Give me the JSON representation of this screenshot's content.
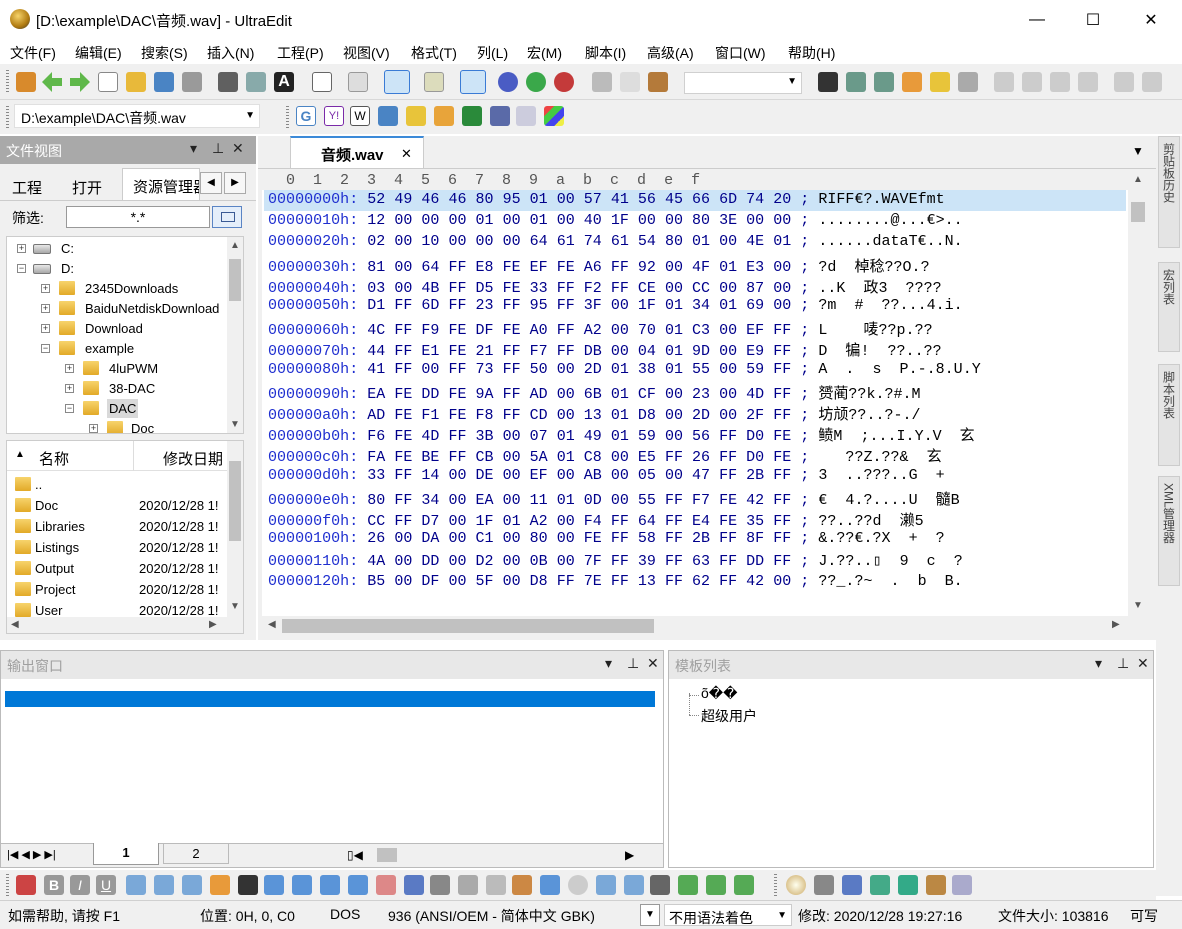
{
  "window": {
    "title": "[D:\\example\\DAC\\音频.wav] - UltraEdit",
    "min": "—",
    "max": "☐",
    "close": "✕"
  },
  "menu": [
    "文件(F)",
    "编辑(E)",
    "搜索(S)",
    "插入(N)",
    "工程(P)",
    "视图(V)",
    "格式(T)",
    "列(L)",
    "宏(M)",
    "脚本(I)",
    "高级(A)",
    "窗口(W)",
    "帮助(H)"
  ],
  "path_combo": "D:\\example\\DAC\\音频.wav",
  "file_view": {
    "title": "文件视图",
    "tabs": [
      "工程",
      "打开",
      "资源管理器"
    ],
    "filter_label": "筛选:",
    "filter_value": "*.*",
    "tree": [
      {
        "label": "C:",
        "level": 0,
        "expander": "+",
        "type": "drive"
      },
      {
        "label": "D:",
        "level": 0,
        "expander": "−",
        "type": "drive"
      },
      {
        "label": "2345Downloads",
        "level": 1,
        "expander": "+",
        "type": "folder"
      },
      {
        "label": "BaiduNetdiskDownload",
        "level": 1,
        "expander": "+",
        "type": "folder"
      },
      {
        "label": "Download",
        "level": 1,
        "expander": "+",
        "type": "folder"
      },
      {
        "label": "example",
        "level": 1,
        "expander": "−",
        "type": "folder"
      },
      {
        "label": "4luPWM",
        "level": 2,
        "expander": "+",
        "type": "folder"
      },
      {
        "label": "38-DAC",
        "level": 2,
        "expander": "+",
        "type": "folder"
      },
      {
        "label": "DAC",
        "level": 2,
        "expander": "−",
        "type": "folder"
      },
      {
        "label": "Doc",
        "level": 3,
        "expander": "+",
        "type": "folder"
      }
    ],
    "list_headers": {
      "name": "名称",
      "date": "修改日期"
    },
    "list": [
      {
        "name": "..",
        "date": ""
      },
      {
        "name": "Doc",
        "date": "2020/12/28 1!"
      },
      {
        "name": "Libraries",
        "date": "2020/12/28 1!"
      },
      {
        "name": "Listings",
        "date": "2020/12/28 1!"
      },
      {
        "name": "Output",
        "date": "2020/12/28 1!"
      },
      {
        "name": "Project",
        "date": "2020/12/28 1!"
      },
      {
        "name": "User",
        "date": "2020/12/28 1!"
      }
    ]
  },
  "editor": {
    "tab": "音频.wav",
    "tab_close": "✕",
    "column_header": "  0  1  2  3  4  5  6  7  8  9  a  b  c  d  e  f",
    "rows": [
      {
        "addr": "00000000h:",
        "hex": "52 49 46 46 80 95 01 00 57 41 56 45 66 6D 74 20",
        "sep": ";",
        "ascii": "RIFF€?.WAVEfmt"
      },
      {
        "addr": "00000010h:",
        "hex": "12 00 00 00 01 00 01 00 40 1F 00 00 80 3E 00 00",
        "sep": ";",
        "ascii": "........@...€>.."
      },
      {
        "addr": "00000020h:",
        "hex": "02 00 10 00 00 00 64 61 74 61 54 80 01 00 4E 01",
        "sep": ";",
        "ascii": "......dataT€..N."
      },
      {
        "addr": "00000030h:",
        "hex": "81 00 64 FF E8 FE EF FE A6 FF 92 00 4F 01 E3 00",
        "sep": ";",
        "ascii": "?d  棹稔??O.?"
      },
      {
        "addr": "00000040h:",
        "hex": "03 00 4B FF D5 FE 33 FF F2 FF CE 00 CC 00 87 00",
        "sep": ";",
        "ascii": "..K  政3  ????"
      },
      {
        "addr": "00000050h:",
        "hex": "D1 FF 6D FF 23 FF 95 FF 3F 00 1F 01 34 01 69 00",
        "sep": ";",
        "ascii": "?m  #  ??...4.i."
      },
      {
        "addr": "00000060h:",
        "hex": "4C FF F9 FE DF FE A0 FF A2 00 70 01 C3 00 EF FF",
        "sep": ";",
        "ascii": "L    唛??p.??"
      },
      {
        "addr": "00000070h:",
        "hex": "44 FF E1 FE 21 FF F7 FF DB 00 04 01 9D 00 E9 FF",
        "sep": ";",
        "ascii": "D  犏!  ??..??"
      },
      {
        "addr": "00000080h:",
        "hex": "41 FF 00 FF 73 FF 50 00 2D 01 38 01 55 00 59 FF",
        "sep": ";",
        "ascii": "A  .  s  P.-.8.U.Y"
      },
      {
        "addr": "00000090h:",
        "hex": "EA FE DD FE 9A FF AD 00 6B 01 CF 00 23 00 4D FF",
        "sep": ";",
        "ascii": "赟蔺??k.?#.M"
      },
      {
        "addr": "000000a0h:",
        "hex": "AD FE F1 FE F8 FF CD 00 13 01 D8 00 2D 00 2F FF",
        "sep": ";",
        "ascii": "坊颃??..?-./"
      },
      {
        "addr": "000000b0h:",
        "hex": "F6 FE 4D FF 3B 00 07 01 49 01 59 00 56 FF D0 FE",
        "sep": ";",
        "ascii": "鲼M  ;...I.Y.V  玄"
      },
      {
        "addr": "000000c0h:",
        "hex": "FA FE BE FF CB 00 5A 01 C8 00 E5 FF 26 FF D0 FE",
        "sep": ";",
        "ascii": "   ??Z.??&  玄"
      },
      {
        "addr": "000000d0h:",
        "hex": "33 FF 14 00 DE 00 EF 00 AB 00 05 00 47 FF 2B FF",
        "sep": ";",
        "ascii": "3  ..???..G  +"
      },
      {
        "addr": "000000e0h:",
        "hex": "80 FF 34 00 EA 00 11 01 0D 00 55 FF F7 FE 42 FF",
        "sep": ";",
        "ascii": "€  4.?....U  髓B"
      },
      {
        "addr": "000000f0h:",
        "hex": "CC FF D7 00 1F 01 A2 00 F4 FF 64 FF E4 FE 35 FF",
        "sep": ";",
        "ascii": "??..??d  濑5"
      },
      {
        "addr": "00000100h:",
        "hex": "26 00 DA 00 C1 00 80 00 FE FF 58 FF 2B FF 8F FF",
        "sep": ";",
        "ascii": "&.??€.?X  +  ?"
      },
      {
        "addr": "00000110h:",
        "hex": "4A 00 DD 00 D2 00 0B 00 7F FF 39 FF 63 FF DD FF",
        "sep": ";",
        "ascii": "J.??..▯  9  c  ?"
      },
      {
        "addr": "00000120h:",
        "hex": "B5 00 DF 00 5F 00 D8 FF 7E FF 13 FF 62 FF 42 00",
        "sep": ";",
        "ascii": "??_.?~  .  b  B."
      }
    ]
  },
  "right_tabs": [
    "剪贴板历史",
    "宏列表",
    "脚本列表",
    "XML管理器"
  ],
  "output_panel": {
    "title": "输出窗口",
    "tabs": [
      "1",
      "2"
    ]
  },
  "templates_panel": {
    "title": "模板列表",
    "items": [
      "õ��",
      "超级用户"
    ]
  },
  "status": {
    "help": "如需帮助, 请按 F1",
    "position": "位置: 0H, 0, C0",
    "line_ending": "DOS",
    "encoding": "936   (ANSI/OEM - 简体中文 GBK)",
    "syntax": "不用语法着色",
    "modified": "修改: 2020/12/28 19:27:16",
    "filesize": "文件大小: 103816",
    "rw": "可写"
  }
}
